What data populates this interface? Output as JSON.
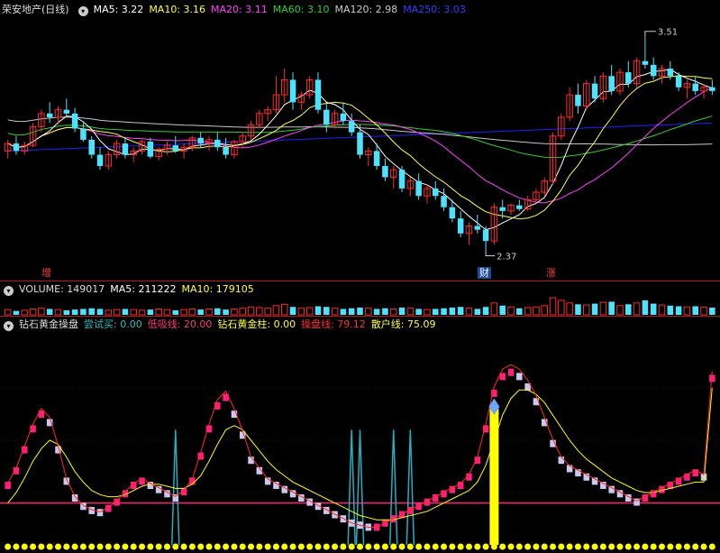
{
  "colors": {
    "up": "#ff2a2a",
    "down": "#4de3ff",
    "ma5": "#ffffff",
    "ma10": "#ffff40",
    "ma20": "#ff40ff",
    "ma60": "#30d030",
    "ma120": "#c8c8c8",
    "ma250": "#2020ff",
    "pink": "#ff1f7a",
    "lav": "#c8c8f0",
    "yellow": "#ffff00",
    "cyan": "#22b0c0"
  },
  "main": {
    "stock_name": "荣安地产(日线)",
    "ma_labels": [
      {
        "label": "MA5: 3.22",
        "color": "#ffffff"
      },
      {
        "label": "MA10: 3.16",
        "color": "#ffff40"
      },
      {
        "label": "MA20: 3.11",
        "color": "#ff40ff"
      },
      {
        "label": "MA60: 3.10",
        "color": "#30d030"
      },
      {
        "label": "MA120: 2.98",
        "color": "#c8c8c8"
      },
      {
        "label": "MA250: 3.03",
        "color": "#3a3aff"
      }
    ],
    "high_label": "3.51",
    "low_label": "2.37",
    "markers": [
      {
        "text": "增",
        "color": "#ff4040",
        "bg": "transparent"
      },
      {
        "text": "财",
        "color": "#ffffff",
        "bg": "#1a4a9a"
      },
      {
        "text": "涨",
        "color": "#ff4040",
        "bg": "transparent"
      }
    ]
  },
  "volume": {
    "title": "VOLUME: 149017",
    "ma_labels": [
      {
        "label": "MA5: 211222",
        "color": "#ffffff"
      },
      {
        "label": "MA10: 179105",
        "color": "#ffff40"
      }
    ]
  },
  "indicator": {
    "title": "钻石黄金操盘",
    "labels": [
      {
        "label": "尝试买: 0.00",
        "color": "#22c0c0"
      },
      {
        "label": "低吸线: 20.00",
        "color": "#ff3a7a"
      },
      {
        "label": "钻石黄金柱: 0.00",
        "color": "#ffff40"
      },
      {
        "label": "操盘线: 79.12",
        "color": "#ff3030"
      },
      {
        "label": "散户线: 75.09",
        "color": "#ffff40"
      }
    ]
  },
  "chart_data": [
    {
      "type": "candlestick",
      "title": "荣安地产(日线)",
      "ylim": [
        2.3,
        3.6
      ],
      "high_annotation": 3.51,
      "low_annotation": 2.37,
      "ohlc": [
        [
          2.9,
          2.96,
          2.86,
          2.94
        ],
        [
          2.94,
          2.98,
          2.88,
          2.9
        ],
        [
          2.9,
          2.95,
          2.88,
          2.93
        ],
        [
          2.93,
          3.05,
          2.92,
          3.03
        ],
        [
          3.03,
          3.12,
          3.0,
          3.1
        ],
        [
          3.1,
          3.16,
          3.05,
          3.08
        ],
        [
          3.08,
          3.14,
          3.04,
          3.12
        ],
        [
          3.12,
          3.18,
          3.08,
          3.1
        ],
        [
          3.1,
          3.13,
          3.0,
          3.02
        ],
        [
          3.02,
          3.05,
          2.95,
          2.96
        ],
        [
          2.96,
          2.98,
          2.86,
          2.88
        ],
        [
          2.88,
          2.92,
          2.8,
          2.82
        ],
        [
          2.82,
          2.9,
          2.8,
          2.88
        ],
        [
          2.88,
          2.96,
          2.86,
          2.94
        ],
        [
          2.94,
          2.97,
          2.86,
          2.88
        ],
        [
          2.88,
          2.92,
          2.84,
          2.9
        ],
        [
          2.9,
          2.96,
          2.88,
          2.95
        ],
        [
          2.95,
          2.97,
          2.86,
          2.87
        ],
        [
          2.87,
          2.92,
          2.85,
          2.91
        ],
        [
          2.91,
          2.95,
          2.88,
          2.93
        ],
        [
          2.93,
          2.98,
          2.89,
          2.9
        ],
        [
          2.9,
          2.94,
          2.86,
          2.92
        ],
        [
          2.92,
          2.98,
          2.9,
          2.97
        ],
        [
          2.97,
          3.0,
          2.92,
          2.94
        ],
        [
          2.94,
          2.98,
          2.9,
          2.96
        ],
        [
          2.96,
          3.0,
          2.9,
          2.92
        ],
        [
          2.92,
          2.97,
          2.86,
          2.88
        ],
        [
          2.88,
          2.96,
          2.86,
          2.95
        ],
        [
          2.95,
          3.0,
          2.92,
          2.98
        ],
        [
          2.98,
          3.06,
          2.96,
          3.04
        ],
        [
          3.04,
          3.12,
          3.02,
          3.1
        ],
        [
          3.1,
          3.14,
          3.06,
          3.12
        ],
        [
          3.12,
          3.3,
          3.1,
          3.2
        ],
        [
          3.2,
          3.34,
          3.16,
          3.28
        ],
        [
          3.28,
          3.32,
          3.12,
          3.16
        ],
        [
          3.16,
          3.22,
          3.12,
          3.2
        ],
        [
          3.2,
          3.3,
          3.18,
          3.28
        ],
        [
          3.28,
          3.32,
          3.1,
          3.12
        ],
        [
          3.12,
          3.15,
          3.0,
          3.04
        ],
        [
          3.04,
          3.12,
          3.02,
          3.1
        ],
        [
          3.1,
          3.16,
          3.04,
          3.06
        ],
        [
          3.06,
          3.1,
          2.98,
          3.0
        ],
        [
          3.0,
          3.04,
          2.86,
          2.88
        ],
        [
          2.88,
          2.92,
          2.82,
          2.9
        ],
        [
          2.9,
          2.94,
          2.8,
          2.82
        ],
        [
          2.82,
          2.86,
          2.74,
          2.76
        ],
        [
          2.76,
          2.82,
          2.7,
          2.8
        ],
        [
          2.8,
          2.82,
          2.68,
          2.7
        ],
        [
          2.7,
          2.76,
          2.66,
          2.74
        ],
        [
          2.74,
          2.78,
          2.64,
          2.66
        ],
        [
          2.66,
          2.72,
          2.62,
          2.7
        ],
        [
          2.7,
          2.74,
          2.64,
          2.66
        ],
        [
          2.66,
          2.7,
          2.58,
          2.6
        ],
        [
          2.6,
          2.64,
          2.52,
          2.54
        ],
        [
          2.54,
          2.58,
          2.44,
          2.46
        ],
        [
          2.46,
          2.52,
          2.4,
          2.5
        ],
        [
          2.5,
          2.56,
          2.46,
          2.48
        ],
        [
          2.48,
          2.5,
          2.37,
          2.42
        ],
        [
          2.42,
          2.62,
          2.4,
          2.6
        ],
        [
          2.6,
          2.64,
          2.54,
          2.58
        ],
        [
          2.58,
          2.62,
          2.56,
          2.61
        ],
        [
          2.61,
          2.64,
          2.58,
          2.59
        ],
        [
          2.59,
          2.66,
          2.58,
          2.64
        ],
        [
          2.64,
          2.7,
          2.62,
          2.68
        ],
        [
          2.68,
          2.76,
          2.66,
          2.74
        ],
        [
          2.74,
          3.0,
          2.72,
          2.98
        ],
        [
          2.98,
          3.1,
          2.96,
          3.08
        ],
        [
          3.08,
          3.24,
          3.06,
          3.2
        ],
        [
          3.2,
          3.26,
          3.1,
          3.14
        ],
        [
          3.14,
          3.28,
          3.12,
          3.26
        ],
        [
          3.26,
          3.3,
          3.16,
          3.18
        ],
        [
          3.18,
          3.32,
          3.16,
          3.3
        ],
        [
          3.3,
          3.36,
          3.2,
          3.22
        ],
        [
          3.22,
          3.34,
          3.2,
          3.32
        ],
        [
          3.32,
          3.38,
          3.24,
          3.26
        ],
        [
          3.26,
          3.4,
          3.24,
          3.38
        ],
        [
          3.38,
          3.51,
          3.34,
          3.36
        ],
        [
          3.36,
          3.4,
          3.28,
          3.3
        ],
        [
          3.3,
          3.36,
          3.26,
          3.34
        ],
        [
          3.34,
          3.38,
          3.28,
          3.3
        ],
        [
          3.3,
          3.32,
          3.22,
          3.24
        ],
        [
          3.24,
          3.28,
          3.18,
          3.26
        ],
        [
          3.26,
          3.3,
          3.2,
          3.22
        ],
        [
          3.22,
          3.26,
          3.18,
          3.24
        ],
        [
          3.24,
          3.28,
          3.2,
          3.22
        ]
      ],
      "ma250": [
        2.9,
        3.05
      ]
    },
    {
      "type": "bar",
      "title": "VOLUME: 149017",
      "values": [
        8,
        6,
        7,
        9,
        10,
        9,
        8,
        7,
        8,
        9,
        10,
        9,
        7,
        8,
        9,
        8,
        7,
        8,
        9,
        8,
        7,
        8,
        9,
        8,
        9,
        10,
        8,
        9,
        10,
        12,
        11,
        10,
        14,
        16,
        12,
        10,
        11,
        13,
        12,
        10,
        9,
        10,
        11,
        10,
        9,
        10,
        9,
        11,
        10,
        9,
        8,
        9,
        10,
        11,
        12,
        10,
        9,
        12,
        18,
        14,
        12,
        10,
        11,
        12,
        14,
        26,
        22,
        18,
        16,
        15,
        17,
        19,
        20,
        14,
        16,
        18,
        22,
        17,
        15,
        14,
        13,
        12,
        13,
        12,
        11
      ]
    },
    {
      "type": "line",
      "title": "钻石黄金操盘",
      "ylim": [
        0,
        100
      ],
      "low_line": 20.0,
      "operate_line": [
        28,
        35,
        45,
        55,
        62,
        58,
        45,
        30,
        22,
        18,
        16,
        15,
        17,
        20,
        24,
        28,
        30,
        28,
        26,
        24,
        22,
        25,
        30,
        42,
        55,
        66,
        70,
        62,
        52,
        40,
        35,
        30,
        28,
        26,
        24,
        22,
        20,
        18,
        16,
        14,
        12,
        10,
        9,
        8,
        8,
        10,
        12,
        14,
        16,
        18,
        20,
        22,
        24,
        26,
        28,
        32,
        40,
        55,
        72,
        80,
        82,
        80,
        75,
        68,
        58,
        48,
        40,
        36,
        34,
        32,
        30,
        28,
        26,
        24,
        22,
        20,
        22,
        24,
        26,
        28,
        30,
        32,
        34,
        32,
        79.12
      ],
      "retail_line": [
        20,
        25,
        32,
        40,
        46,
        50,
        48,
        42,
        35,
        30,
        26,
        24,
        23,
        23,
        24,
        26,
        28,
        29,
        29,
        28,
        27,
        27,
        29,
        33,
        40,
        48,
        55,
        57,
        55,
        50,
        45,
        40,
        36,
        33,
        30,
        28,
        26,
        24,
        22,
        20,
        18,
        16,
        14,
        13,
        12,
        12,
        12,
        13,
        14,
        15,
        16,
        18,
        20,
        22,
        24,
        26,
        30,
        38,
        50,
        62,
        70,
        74,
        74,
        72,
        68,
        62,
        56,
        50,
        45,
        41,
        38,
        35,
        32,
        30,
        28,
        26,
        25,
        25,
        26,
        27,
        28,
        29,
        30,
        30,
        75.09
      ]
    }
  ]
}
